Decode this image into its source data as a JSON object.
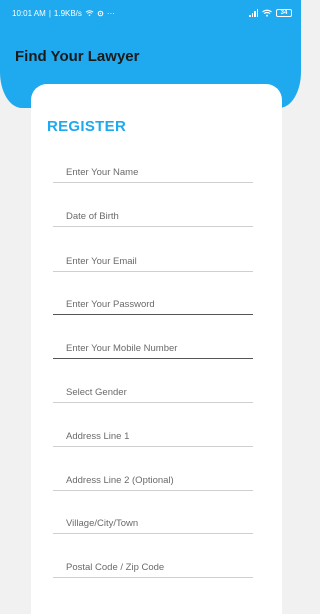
{
  "status_bar": {
    "time": "10:01 AM",
    "speed": "1.9KB/s",
    "overflow": "···",
    "battery": "34"
  },
  "app": {
    "title": "Find Your Lawyer"
  },
  "form": {
    "title": "REGISTER",
    "fields": [
      {
        "placeholder": "Enter Your Name"
      },
      {
        "placeholder": "Date of Birth"
      },
      {
        "placeholder": "Enter Your Email"
      },
      {
        "placeholder": "Enter Your Password"
      },
      {
        "placeholder": "Enter Your Mobile Number"
      },
      {
        "placeholder": "Select Gender"
      },
      {
        "placeholder": "Address Line 1"
      },
      {
        "placeholder": "Address Line 2 (Optional)"
      },
      {
        "placeholder": "Village/City/Town"
      },
      {
        "placeholder": "Postal Code / Zip Code"
      }
    ]
  },
  "colors": {
    "accent": "#1fa9ee",
    "background": "#f1f1f1",
    "card": "#ffffff"
  },
  "icons": [
    "wifi-icon",
    "gear-icon",
    "signal-icon",
    "battery-icon"
  ]
}
